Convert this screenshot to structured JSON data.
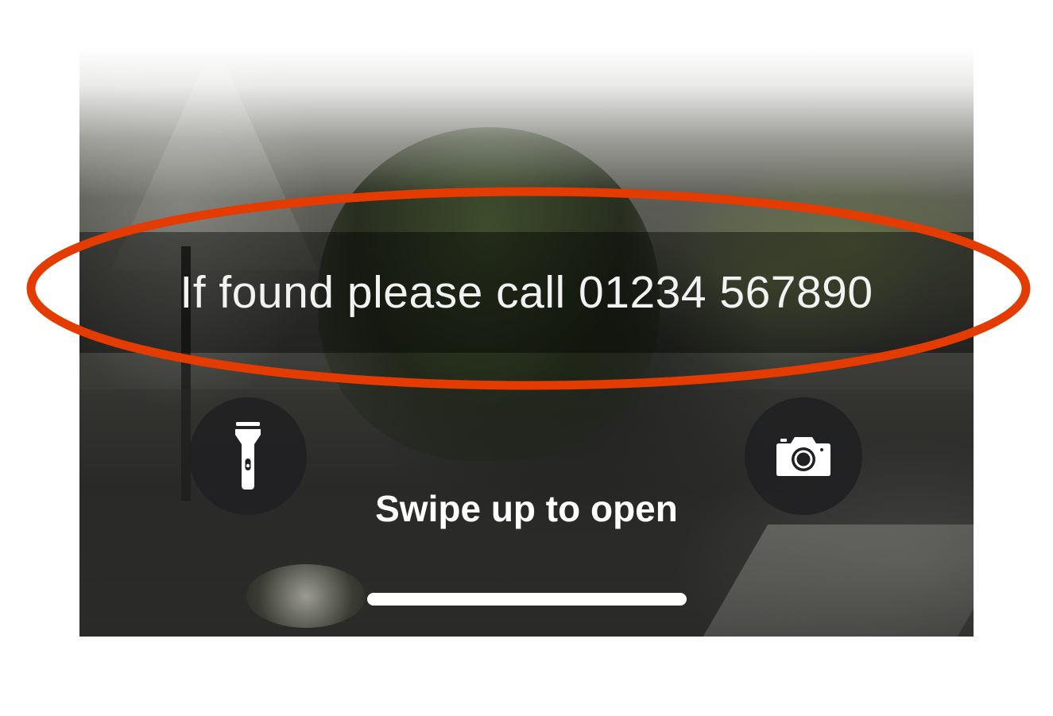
{
  "lock_screen": {
    "owner_message": "If found please call 01234 567890",
    "swipe_hint": "Swipe up to open"
  },
  "quick_actions": {
    "flashlight": {
      "icon": "flashlight-icon"
    },
    "camera": {
      "icon": "camera-icon"
    }
  },
  "colors": {
    "highlight_ring": "#e33b00",
    "message_text": "#f2f2f2",
    "button_background": "#202022",
    "home_indicator": "#ffffff"
  }
}
